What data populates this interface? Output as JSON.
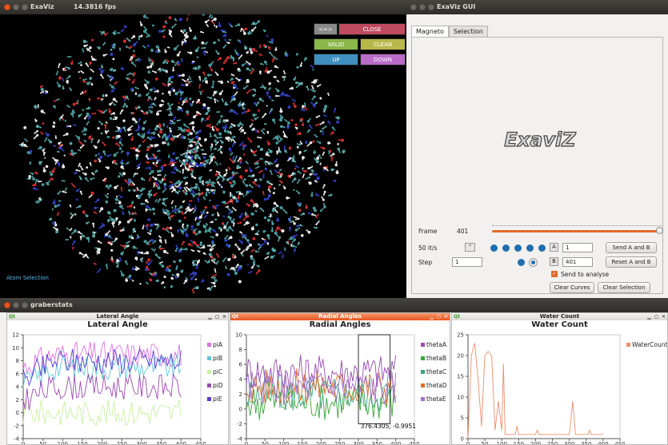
{
  "viewer": {
    "title": "ExaViz",
    "fps": "14.3816 fps",
    "atom_selection": "Atom Selection",
    "buttons": [
      {
        "label": "<=>",
        "color": "#8a8a8a"
      },
      {
        "label": "CLOSE",
        "color": "#c04a60"
      },
      {
        "label": "VALID",
        "color": "#8ab84a"
      },
      {
        "label": "CLEAN",
        "color": "#b8b84a"
      },
      {
        "label": "UP",
        "color": "#3f8fbf"
      },
      {
        "label": "DOWN",
        "color": "#b86cc8"
      }
    ]
  },
  "gui": {
    "title": "ExaViz GUI",
    "tabs": [
      "Magneto",
      "Selection"
    ],
    "logo": "ExaviZ",
    "frame_label": "Frame",
    "frame_value": "401",
    "rate_label": "50 it/s",
    "step_label": "Step",
    "step_value": "1",
    "a_label": "A",
    "a_value": "1",
    "b_label": "B",
    "b_value": "401",
    "send_ab": "Send A and B",
    "reset_ab": "Reset A and B",
    "send_analyse": "Send to analyse",
    "clear_curves": "Clear Curves",
    "clear_selection": "Clear Selection"
  },
  "stats": {
    "window_title": "graberstats",
    "panels": [
      {
        "window": "Lateral Angle",
        "title": "Lateral Angle",
        "qt": "Qt",
        "controls": "▁ ◻ ✕"
      },
      {
        "window": "Radial Angles",
        "title": "Radial Angles",
        "qt": "Qt",
        "controls": "▁ ◻ ✕"
      },
      {
        "window": "Water Count",
        "title": "Water Count",
        "qt": "Qt",
        "controls": "▁ ◻ ✕"
      }
    ],
    "tooltip": "376.4305, -0.9951"
  },
  "chart_data": [
    {
      "type": "line",
      "title": "Lateral Angle",
      "xlim": [
        0,
        450
      ],
      "ylim": [
        -4,
        12
      ],
      "xticks": [
        "0",
        "50",
        "100",
        "150",
        "200",
        "250",
        "300",
        "350",
        "400",
        "450"
      ],
      "yticks": [
        "-4",
        "-2",
        "0",
        "2",
        "4",
        "6",
        "8",
        "10",
        "12"
      ],
      "series": [
        {
          "name": "piA",
          "color": "#e070e0"
        },
        {
          "name": "piB",
          "color": "#60c8d8"
        },
        {
          "name": "piC",
          "color": "#c8f0a0"
        },
        {
          "name": "piD",
          "color": "#9a4ab0"
        },
        {
          "name": "piE",
          "color": "#5a3ad0"
        }
      ]
    },
    {
      "type": "line",
      "title": "Radial Angles",
      "xlim": [
        0,
        450
      ],
      "ylim": [
        -4,
        10
      ],
      "xticks": [
        "0",
        "50",
        "100",
        "150",
        "200",
        "250",
        "300",
        "350",
        "400",
        "450"
      ],
      "yticks": [
        "-4",
        "-2",
        "0",
        "2",
        "4",
        "6",
        "8",
        "10"
      ],
      "series": [
        {
          "name": "thetaA",
          "color": "#9a4ab0"
        },
        {
          "name": "thetaB",
          "color": "#3aa83a"
        },
        {
          "name": "thetaC",
          "color": "#40a080"
        },
        {
          "name": "thetaD",
          "color": "#d87030"
        },
        {
          "name": "thetaE",
          "color": "#a070d0"
        }
      ]
    },
    {
      "type": "line",
      "title": "Water Count",
      "xlim": [
        0,
        450
      ],
      "ylim": [
        0,
        25
      ],
      "xticks": [
        "0",
        "50",
        "100",
        "150",
        "200",
        "250",
        "300",
        "350",
        "400",
        "450"
      ],
      "yticks": [
        "0",
        "5",
        "10",
        "15",
        "20",
        "25"
      ],
      "series": [
        {
          "name": "WaterCount",
          "color": "#e8906a"
        }
      ]
    }
  ]
}
